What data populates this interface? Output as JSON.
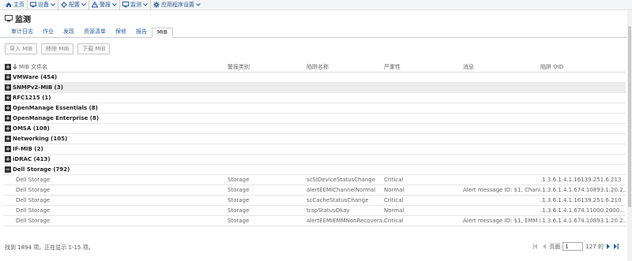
{
  "nav": [
    {
      "label": "主页",
      "icon": "home-icon",
      "dropdown": false
    },
    {
      "label": "设备",
      "icon": "devices-icon",
      "dropdown": true
    },
    {
      "label": "配置",
      "icon": "configuration-icon",
      "dropdown": true
    },
    {
      "label": "警报",
      "icon": "alerts-icon",
      "dropdown": true
    },
    {
      "label": "监测",
      "icon": "monitoring-icon",
      "dropdown": true
    },
    {
      "label": "应用程序设置",
      "icon": "settings-gear-icon",
      "dropdown": true
    }
  ],
  "page": {
    "title": "监测"
  },
  "tabs": [
    "审计日志",
    "作业",
    "发现",
    "资源清单",
    "保修",
    "报告",
    "MIB"
  ],
  "active_tab": "MIB",
  "toolbar": {
    "import": "导入 MIB",
    "remove": "移除 MIB",
    "download": "下载 MIB"
  },
  "columns": {
    "name": "MIB 文件名",
    "category": "警报类别",
    "trap_name": "陷阱名称",
    "severity": "严重性",
    "message": "消息",
    "oid": "陷阱 OID"
  },
  "groups": [
    {
      "label": "VMWare (454)",
      "expanded": false,
      "highlighted": false
    },
    {
      "label": "SNMPv2-MIB (3)",
      "expanded": false,
      "highlighted": true
    },
    {
      "label": "RFC1215 (1)",
      "expanded": false,
      "highlighted": false
    },
    {
      "label": "OpenManage Essentials (8)",
      "expanded": false,
      "highlighted": false
    },
    {
      "label": "OpenManage Enterprise (8)",
      "expanded": false,
      "highlighted": false
    },
    {
      "label": "OMSA (108)",
      "expanded": false,
      "highlighted": false
    },
    {
      "label": "Networking (105)",
      "expanded": false,
      "highlighted": false
    },
    {
      "label": "IF-MIB (2)",
      "expanded": false,
      "highlighted": false
    },
    {
      "label": "iDRAC (413)",
      "expanded": false,
      "highlighted": false
    },
    {
      "label": "Dell Storage (792)",
      "expanded": true,
      "highlighted": false
    }
  ],
  "rows": [
    {
      "name": "Dell Storage",
      "category": "Storage",
      "trap_name": "scSIDeviceStatusChange",
      "severity": "Critical",
      "message": "",
      "oid": ".1.3.6.1.4.1.16139.251.6.213"
    },
    {
      "name": "Dell Storage",
      "category": "Storage",
      "trap_name": "alertEEMIChannelNormal",
      "severity": "Normal",
      "message": "Alert message ID: $1, Chann...",
      "oid": ".1.3.6.1.4.1.674.10893.1.20.2..."
    },
    {
      "name": "Dell Storage",
      "category": "Storage",
      "trap_name": "scCacheStatusChange",
      "severity": "Critical",
      "message": "",
      "oid": ".1.3.6.1.4.1.16139.251.6.210"
    },
    {
      "name": "Dell Storage",
      "category": "Storage",
      "trap_name": "trapStatusOkay",
      "severity": "Normal",
      "message": "",
      "oid": ".1.3.6.1.4.1.674.11000.2000..."
    },
    {
      "name": "Dell Storage",
      "category": "Storage",
      "trap_name": "alertEEMIEMMNonRecovera...",
      "severity": "Critical",
      "message": "Alert message ID: $1, EMM i...",
      "oid": ".1.3.6.1.4.1.674.10893.1.20.2..."
    }
  ],
  "footer": {
    "status": "找到 1894 项。正在显示 1-15 项。",
    "page_label": "页面",
    "page_value": "1",
    "page_total": "127 的"
  }
}
